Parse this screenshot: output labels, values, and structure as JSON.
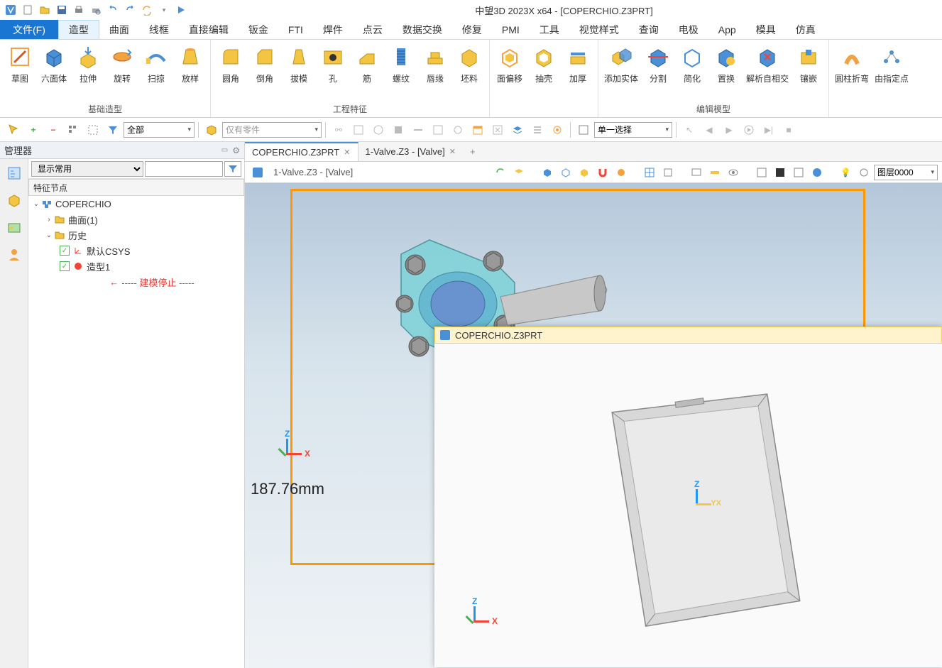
{
  "app": {
    "title": "中望3D 2023X x64 - [COPERCHIO.Z3PRT]"
  },
  "menu": {
    "file": "文件(F)",
    "items": [
      "造型",
      "曲面",
      "线框",
      "直接编辑",
      "钣金",
      "FTI",
      "焊件",
      "点云",
      "数据交换",
      "修复",
      "PMI",
      "工具",
      "视觉样式",
      "查询",
      "电极",
      "App",
      "模具",
      "仿真"
    ]
  },
  "ribbon": {
    "groups": [
      {
        "label": "基础造型",
        "buttons": [
          "草图",
          "六面体",
          "拉伸",
          "旋转",
          "扫掠",
          "放样"
        ]
      },
      {
        "label": "工程特征",
        "buttons": [
          "圆角",
          "倒角",
          "拔模",
          "孔",
          "筋",
          "螺纹",
          "唇缘",
          "坯料"
        ]
      },
      {
        "label": "",
        "buttons": [
          "面偏移",
          "抽壳",
          "加厚"
        ]
      },
      {
        "label": "编辑模型",
        "buttons": [
          "添加实体",
          "分割",
          "简化",
          "置换",
          "解析自相交",
          "镶嵌"
        ]
      },
      {
        "label": "",
        "buttons": [
          "圆柱折弯",
          "由指定点"
        ]
      }
    ]
  },
  "toolbar2": {
    "filter_all": "全部",
    "parts_only": "仅有零件",
    "select_mode": "单一选择"
  },
  "doctabs": {
    "tab1": "COPERCHIO.Z3PRT",
    "tab2": "1-Valve.Z3 - [Valve]"
  },
  "panel": {
    "title": "管理器",
    "show_common": "显示常用",
    "section": "特征节点",
    "tree": {
      "root": "COPERCHIO",
      "surface": "曲面(1)",
      "history": "历史",
      "default_csys": "默认CSYS",
      "shape1": "造型1",
      "stop": "----- 建模停止 -----"
    }
  },
  "viewport": {
    "breadcrumb": "1-Valve.Z3 - [Valve]",
    "measurement": "187.76mm",
    "layer": "图层0000",
    "popup_title": "COPERCHIO.Z3PRT"
  }
}
